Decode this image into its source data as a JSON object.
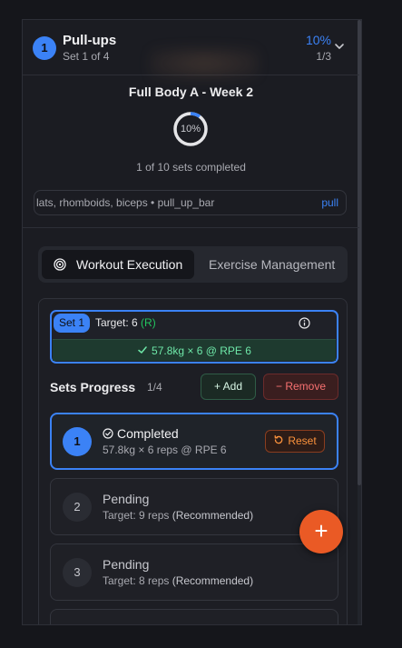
{
  "exercise": {
    "number": "1",
    "name": "Pull-ups",
    "set_info": "Set 1 of 4",
    "percent": "10%",
    "fraction": "1/3"
  },
  "workout": {
    "title": "Full Body A - Week 2",
    "ring_label": "10%",
    "progress_fraction": 0.1,
    "sets_completed": "1 of 10 sets completed",
    "muscles": "lats, rhomboids, biceps • pull_up_bar",
    "movement": "pull"
  },
  "tabs": [
    {
      "label": "Workout Execution"
    },
    {
      "label": "Exercise Management"
    }
  ],
  "current_set": {
    "badge": "Set 1",
    "target": "Target: 6",
    "target_suffix": "(R)",
    "result": "57.8kg × 6 @ RPE 6"
  },
  "sets_progress": {
    "title": "Sets Progress",
    "count": "1/4",
    "add_label": "Add",
    "remove_label": "Remove",
    "rows": [
      {
        "n": "1",
        "status": "Completed",
        "detail": "57.8kg × 6 reps @ RPE 6",
        "action": "Reset"
      },
      {
        "n": "2",
        "status": "Pending",
        "detail": "Target: 9 reps",
        "rec": "(Recommended)"
      },
      {
        "n": "3",
        "status": "Pending",
        "detail": "Target: 8 reps",
        "rec": "(Recommended)"
      }
    ]
  },
  "fab_label": "+",
  "colors": {
    "accent": "#3b82f6",
    "success": "#22c55e",
    "danger": "#f87171",
    "warning": "#fb923c",
    "fab": "#ea5a25"
  }
}
